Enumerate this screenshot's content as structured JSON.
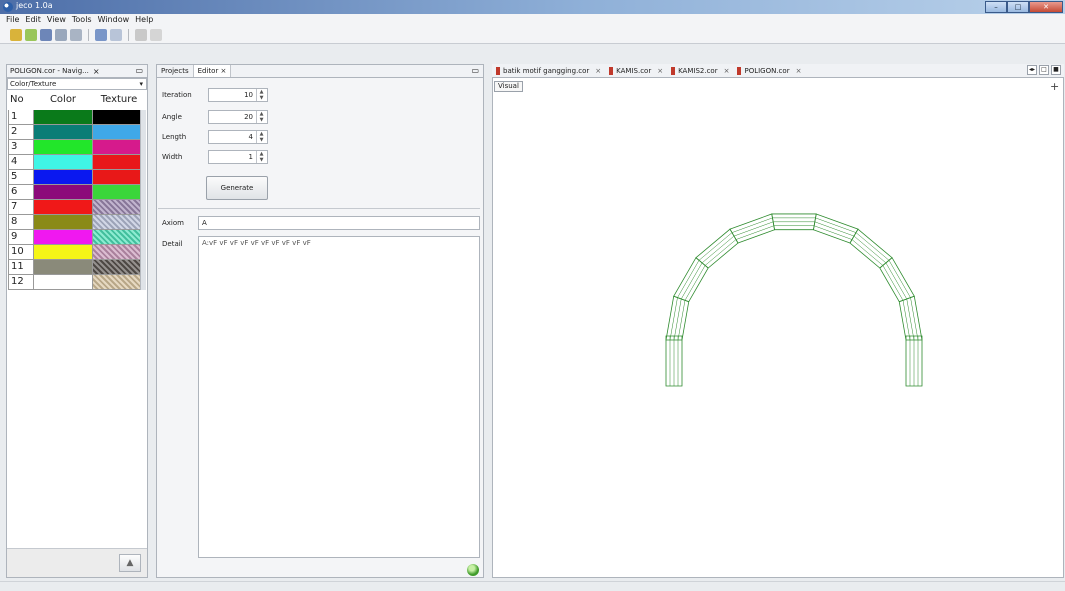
{
  "window": {
    "title": "jeco 1.0a"
  },
  "menu": [
    "File",
    "Edit",
    "View",
    "Tools",
    "Window",
    "Help"
  ],
  "left_panel": {
    "tab_label": "POLIGON.cor - Navig...",
    "dropdown_value": "Color/Texture",
    "headers": {
      "no": "No",
      "color": "Color",
      "texture": "Texture"
    },
    "rows": [
      {
        "no": "1",
        "color": "#0a7a1a",
        "texture": "#000000"
      },
      {
        "no": "2",
        "color": "#0a7d76",
        "texture": "#3fa8e8"
      },
      {
        "no": "3",
        "color": "#22e62a",
        "texture": "#d61a8c"
      },
      {
        "no": "4",
        "color": "#3ff5e6",
        "texture": "#e8181a"
      },
      {
        "no": "5",
        "color": "#0a18f0",
        "texture": "#e81818"
      },
      {
        "no": "6",
        "color": "#8c0a7a",
        "texture": "#3ad63a"
      },
      {
        "no": "7",
        "color": "#f01818",
        "texture": "#a08cb4"
      },
      {
        "no": "8",
        "color": "#8a8a18",
        "texture": "#b8c0d8"
      },
      {
        "no": "9",
        "color": "#f018f0",
        "texture": "#4ee0b8"
      },
      {
        "no": "10",
        "color": "#f5f518",
        "texture": "#c898b8"
      },
      {
        "no": "11",
        "color": "#8a8a7a",
        "texture": "#5a5450"
      },
      {
        "no": "12",
        "color": "#ffffff",
        "texture": "#d8c4a0"
      }
    ]
  },
  "editor": {
    "tabs": [
      "Projects",
      "Editor"
    ],
    "fields": [
      {
        "label": "Iteration",
        "value": "10"
      },
      {
        "label": "Angle",
        "value": "20"
      },
      {
        "label": "Length",
        "value": "4"
      },
      {
        "label": "Width",
        "value": "1"
      }
    ],
    "generate_label": "Generate",
    "axiom_label": "Axiom",
    "axiom_value": "A",
    "detail_label": "Detail",
    "detail_value": "A:vF vF vF vF vF vF vF vF vF vF"
  },
  "viewer": {
    "tabs": [
      "batik motif gangging.cor",
      "KAMIS.cor",
      "KAMIS2.cor",
      "POLIGON.cor"
    ],
    "visual_tab": "Visual",
    "arch_color": "#2e8b2e"
  }
}
